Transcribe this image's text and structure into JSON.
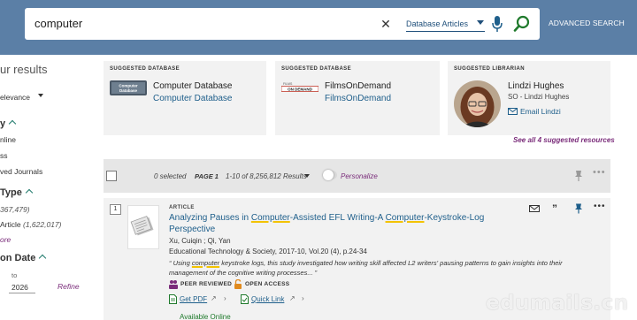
{
  "header": {
    "search_query": "computer",
    "scope": "Database Articles",
    "advanced_search": "ADVANCED SEARCH",
    "icons": [
      "close-icon",
      "microphone-icon",
      "search-icon"
    ]
  },
  "sidebar": {
    "results_title": "ur results",
    "sort_value": "elevance",
    "facets": [
      {
        "head": "y",
        "items": [
          "nline",
          "ss",
          "ved Journals"
        ]
      },
      {
        "head": "Type",
        "items": [
          {
            "label": "",
            "count": "367,479)"
          },
          {
            "label": "Article",
            "count": "(1,622,017)"
          }
        ],
        "more": "ore"
      },
      {
        "head": "on Date",
        "to_label": "to",
        "year": "2026",
        "refine": "Refine"
      }
    ]
  },
  "suggestions": [
    {
      "label": "SUGGESTED DATABASE",
      "title": "Computer Database",
      "link": "Computer Database",
      "logo_text": "Computer Database"
    },
    {
      "label": "SUGGESTED DATABASE",
      "title": "FilmsOnDemand",
      "link": "FilmsOnDemand",
      "logo_text": "ON DEMAND"
    },
    {
      "label": "SUGGESTED LIBRARIAN",
      "name": "Lindzi Hughes",
      "role": "SO - Lindzi Hughes",
      "email": "Email Lindzi"
    }
  ],
  "see_all": "See all 4 suggested resources",
  "toolbar": {
    "selected": "0 selected",
    "page": "PAGE 1",
    "results": "1-10 of 8,256,812 Results",
    "personalize": "Personalize"
  },
  "result": {
    "rank": "1",
    "type": "ARTICLE",
    "title_parts": [
      "Analyzing Pauses in ",
      "Computer",
      "-Assisted EFL Writing-A ",
      "Computer",
      "-Keystroke-Log Perspective"
    ],
    "authors": "Xu, Cuiqin ; Qi, Yan",
    "source": "Educational Technology & Society, 2017-10, Vol.20 (4), p.24-34",
    "snippet_parts": [
      "Using ",
      "computer",
      " keystroke logs, this study investigated how writing skill affected L2 writers' pausing patterns to gain insights into their management of the cognitive writing processes..."
    ],
    "badges": [
      "PEER REVIEWED",
      "OPEN ACCESS"
    ],
    "links": [
      "Get PDF",
      "Quick Link"
    ],
    "availability": "Available Online"
  },
  "watermark": "edumails.cn",
  "colors": {
    "header": "#5b7fa6",
    "link": "#1f5f8b",
    "accent": "#7a2c7a",
    "highlight": "#f3c300",
    "open_access": "#e08a1e"
  }
}
